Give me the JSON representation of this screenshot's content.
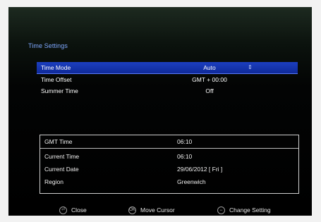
{
  "screen": {
    "title": "Time Settings"
  },
  "settings": {
    "items": [
      {
        "label": "Time Mode",
        "value": "Auto",
        "selected": true,
        "marker": "⇕"
      },
      {
        "label": "Time Offset",
        "value": "GMT + 00:00",
        "selected": false
      },
      {
        "label": "Summer Time",
        "value": "Off",
        "selected": false
      }
    ]
  },
  "info": {
    "rows": [
      {
        "label": "GMT Time",
        "value": "06:10"
      },
      {
        "label": "Current Time",
        "value": "06:10"
      },
      {
        "label": "Current Date",
        "value": "29/06/2012 [ Fri ]"
      },
      {
        "label": "Region",
        "value": "Greenwich"
      }
    ]
  },
  "footer": {
    "close_label": "Close",
    "move_label": "Move Cursor",
    "change_label": "Change Setting",
    "icons": {
      "close": "exit-button-icon",
      "move": "ok-button-icon",
      "change": "arrow-button-icon"
    }
  }
}
